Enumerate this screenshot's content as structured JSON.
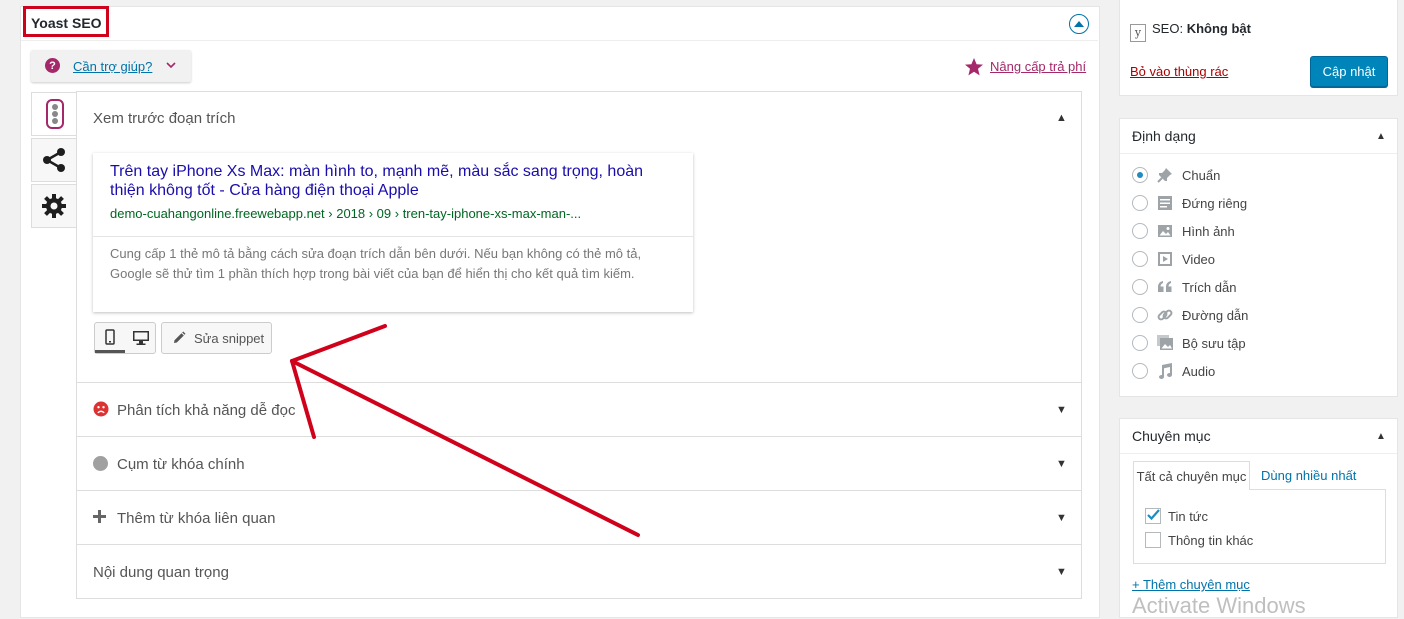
{
  "yoast": {
    "title": "Yoast SEO",
    "help_label": "Cần trợ giúp?",
    "upgrade_label": "Nâng cấp trả phí",
    "preview_title": "Xem trước đoạn trích",
    "snippet": {
      "title": "Trên tay iPhone Xs Max: màn hình to, mạnh mẽ, màu sắc sang trọng, hoàn thiện không tốt - Cửa hàng điện thoại Apple",
      "url": "demo-cuahangonline.freewebapp.net › 2018 › 09 › tren-tay-iphone-xs-max-man-...",
      "description": "Cung cấp 1 thẻ mô tả bằng cách sửa đoạn trích dẫn bên dưới. Nếu bạn không có thẻ mô tả, Google sẽ thử tìm 1 phần thích hợp trong bài viết của bạn để hiển thị cho kết quả tìm kiếm."
    },
    "edit_snippet_label": "Sửa snippet",
    "sections": [
      {
        "label": "Phân tích khả năng dễ đọc",
        "status_color": "#dc3232"
      },
      {
        "label": "Cụm từ khóa chính",
        "status_color": "#a0a0a0"
      },
      {
        "label": "Thêm từ khóa liên quan"
      },
      {
        "label": "Nội dung quan trọng"
      }
    ]
  },
  "publish": {
    "seo_label": "SEO:",
    "seo_value": "Không bật",
    "trash_label": "Bỏ vào thùng rác",
    "update_label": "Cập nhật"
  },
  "format": {
    "title": "Định dạng",
    "options": [
      "Chuẩn",
      "Đứng riêng",
      "Hình ảnh",
      "Video",
      "Trích dẫn",
      "Đường dẫn",
      "Bộ sưu tập",
      "Audio"
    ],
    "selected": "Chuẩn"
  },
  "categories": {
    "title": "Chuyên mục",
    "tab_all": "Tất cả chuyên mục",
    "tab_popular": "Dùng nhiều nhất",
    "items": [
      {
        "label": "Tin tức",
        "checked": true
      },
      {
        "label": "Thông tin khác",
        "checked": false
      }
    ],
    "add_label": "+ Thêm chuyên mục"
  },
  "watermark": "Activate Windows",
  "colors": {
    "accent": "#0073aa",
    "yoast_purple": "#a4286a",
    "annotation_red": "#d0021b",
    "primary_button": "#0085ba"
  }
}
